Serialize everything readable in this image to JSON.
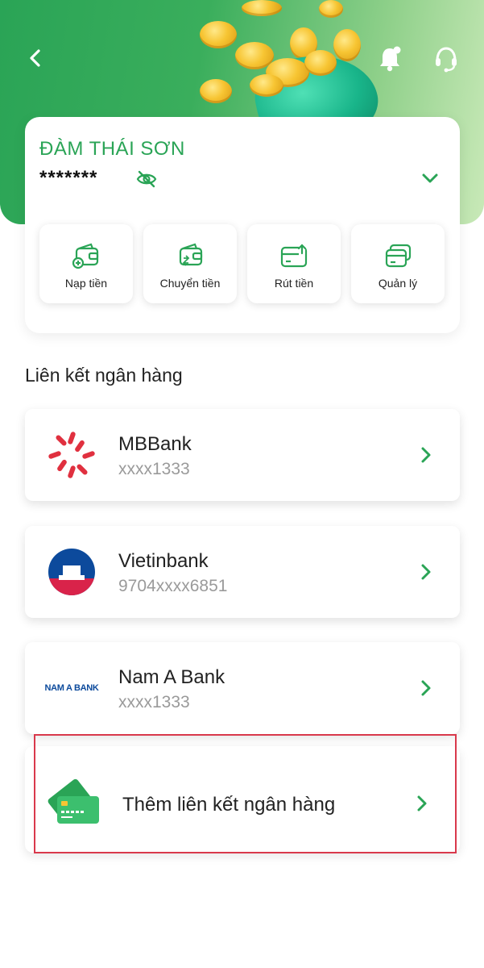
{
  "header": {
    "back_icon": "chevron-left-icon",
    "bell_icon": "bell-icon",
    "support_icon": "headset-icon"
  },
  "account": {
    "name": "ĐÀM THÁI SƠN",
    "balance_masked": "*******",
    "visibility_icon": "eye-off-icon",
    "expand_icon": "chevron-down-icon"
  },
  "actions": [
    {
      "label": "Nạp tiền",
      "icon": "wallet-plus-icon"
    },
    {
      "label": "Chuyển tiền",
      "icon": "wallet-transfer-icon"
    },
    {
      "label": "Rút tiền",
      "icon": "card-withdraw-icon"
    },
    {
      "label": "Quản lý",
      "icon": "cards-manage-icon"
    }
  ],
  "linked_banks": {
    "title": "Liên kết ngân hàng",
    "items": [
      {
        "name": "MBBank",
        "account": "xxxx1333"
      },
      {
        "name": "Vietinbank",
        "account": "9704xxxx6851"
      },
      {
        "name": "Nam A Bank",
        "account": "xxxx1333",
        "logo_text": "NAM A BANK"
      }
    ],
    "add_label": "Thêm liên kết ngân hàng"
  },
  "colors": {
    "brand_green": "#2aa456",
    "highlight_red": "#d9394c",
    "mb_red": "#e0303f",
    "vietin_blue": "#0c4a9c"
  }
}
